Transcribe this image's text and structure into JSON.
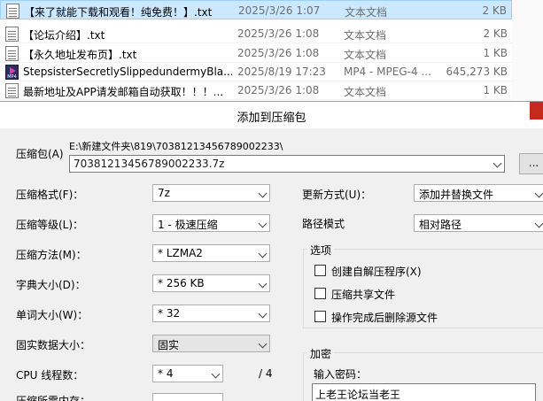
{
  "file_list": {
    "rows": [
      {
        "name": "【来了就能下载和观看！纯免费！】.txt",
        "date": "2025/3/26 1:07",
        "type": "文本文档",
        "size": "2 KB",
        "icon": "txt-file-icon",
        "selected": true
      },
      {
        "name": "【论坛介绍】.txt",
        "date": "2025/3/26 1:08",
        "type": "文本文档",
        "size": "2 KB",
        "icon": "txt-file-icon",
        "selected": false
      },
      {
        "name": "【永久地址发布页】.txt",
        "date": "2025/3/26 1:08",
        "type": "文本文档",
        "size": "1 KB",
        "icon": "txt-file-icon",
        "selected": false
      },
      {
        "name": "StepsisterSecretlySlippedundermyBla...",
        "date": "2025/8/19 17:23",
        "type": "MP4 - MPEG-4 ...",
        "size": "645,273 KB",
        "icon": "mp4-file-icon",
        "selected": false
      },
      {
        "name": "最新地址及APP请发邮箱自动获取！！！...",
        "date": "2025/3/26 1:08",
        "type": "文本文档",
        "size": "1 KB",
        "icon": "txt-file-icon",
        "selected": false
      }
    ]
  },
  "dialog": {
    "title": "添加到压缩包",
    "archive": {
      "label": "压缩包(A)",
      "folder": "E:\\新建文件夹\\819\\70381213456789002233\\",
      "filename": "70381213456789002233.7z",
      "browse_label": "..."
    },
    "left_fields": [
      {
        "name": "format",
        "label": "压缩格式(F)：",
        "value": "7z"
      },
      {
        "name": "level",
        "label": "压缩等级(L)：",
        "value": "1 - 极速压缩"
      },
      {
        "name": "method",
        "label": "压缩方法(M)：",
        "value": "* LZMA2"
      },
      {
        "name": "dict",
        "label": "字典大小(D)：",
        "value": "* 256 KB"
      },
      {
        "name": "word",
        "label": "单词大小(W)：",
        "value": "* 32"
      },
      {
        "name": "solid",
        "label": "固实数据大小：",
        "value": "固实"
      }
    ],
    "cpu": {
      "label": "CPU 线程数：",
      "value": "* 4",
      "max": "/ 4"
    },
    "memory": {
      "label": "压缩所需内存："
    },
    "update": {
      "label": "更新方式(U)：",
      "value": "添加并替换文件"
    },
    "path_mode": {
      "label": "路径模式",
      "value": "相对路径"
    },
    "options": {
      "title": "选项",
      "items": [
        {
          "label": "创建自解压程序(X)",
          "checked": false
        },
        {
          "label": "压缩共享文件",
          "checked": false
        },
        {
          "label": "操作完成后删除源文件",
          "checked": false
        }
      ]
    },
    "encryption": {
      "title": "加密",
      "password_label": "输入密码：",
      "password_value": "上老王论坛当老王"
    }
  }
}
